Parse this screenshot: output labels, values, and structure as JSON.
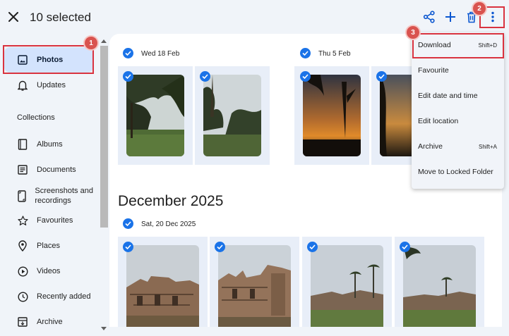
{
  "header": {
    "title": "10 selected",
    "close_icon": "close-icon",
    "actions": [
      "share-icon",
      "add-icon",
      "delete-icon",
      "more-vert-icon"
    ]
  },
  "sidebar": {
    "items": [
      {
        "label": "Photos",
        "icon": "photo-icon",
        "active": true
      },
      {
        "label": "Updates",
        "icon": "bell-icon"
      }
    ],
    "collections_label": "Collections",
    "collections": [
      {
        "label": "Albums",
        "icon": "album-icon"
      },
      {
        "label": "Documents",
        "icon": "document-icon"
      },
      {
        "label": "Screenshots and recordings",
        "icon": "phone-icon"
      },
      {
        "label": "Favourites",
        "icon": "star-icon"
      },
      {
        "label": "Places",
        "icon": "pin-icon"
      },
      {
        "label": "Videos",
        "icon": "play-icon"
      },
      {
        "label": "Recently added",
        "icon": "clock-icon"
      },
      {
        "label": "Archive",
        "icon": "archive-icon"
      }
    ]
  },
  "main": {
    "groups": [
      {
        "date": "Wed 18 Feb",
        "photos": 2
      },
      {
        "date": "Thu 5 Feb",
        "photos": 2
      }
    ],
    "month_heading": "December 2025",
    "dec_group": {
      "date": "Sat, 20 Dec 2025",
      "photos": 4
    }
  },
  "menu": {
    "items": [
      {
        "label": "Download",
        "shortcut": "Shift+D",
        "highlighted": true
      },
      {
        "label": "Favourite",
        "shortcut": ""
      },
      {
        "label": "Edit date and time",
        "shortcut": ""
      },
      {
        "label": "Edit location",
        "shortcut": ""
      },
      {
        "label": "Archive",
        "shortcut": "Shift+A"
      },
      {
        "label": "Move to Locked Folder",
        "shortcut": ""
      }
    ]
  },
  "annotations": [
    {
      "number": "1",
      "target": "Photos"
    },
    {
      "number": "2",
      "target": "More options"
    },
    {
      "number": "3",
      "target": "Download"
    }
  ],
  "colors": {
    "accent": "#1a73e8",
    "active_nav": "#d3e3fd",
    "annotation": "#d9333f",
    "background": "#f0f4f9"
  }
}
